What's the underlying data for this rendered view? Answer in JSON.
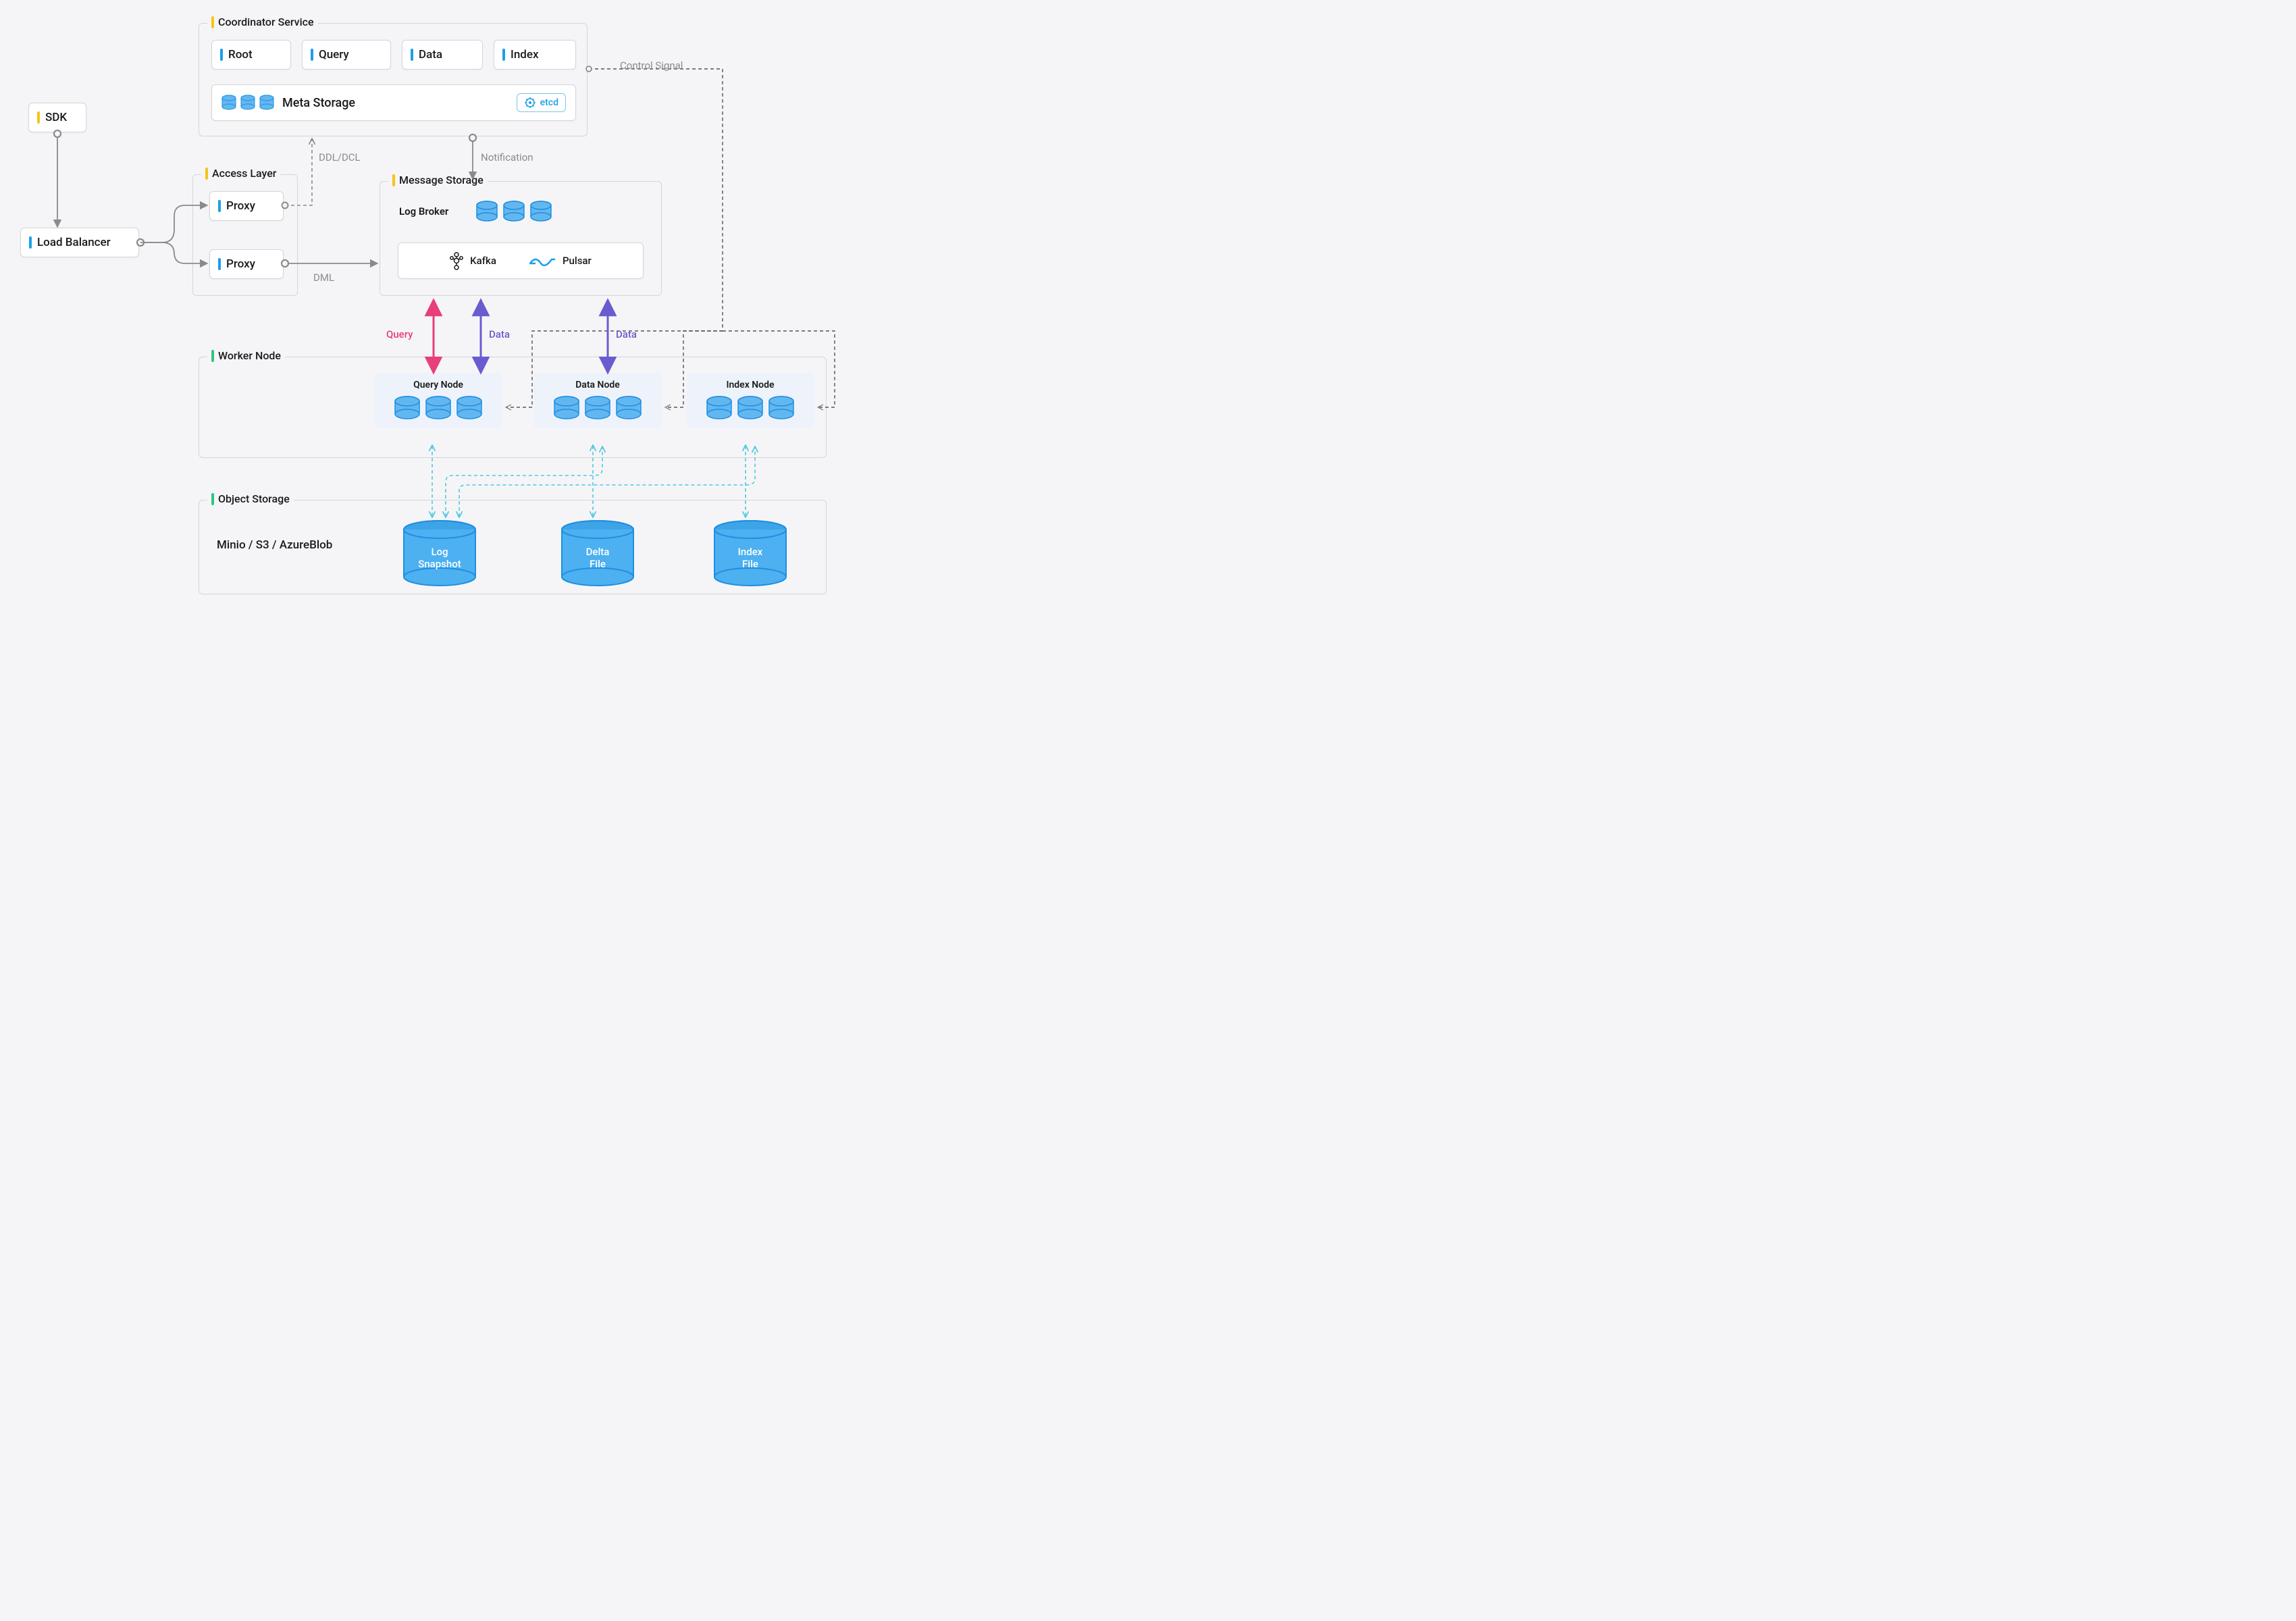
{
  "sdk": {
    "label": "SDK"
  },
  "load_balancer": {
    "label": "Load Balancer"
  },
  "access_layer": {
    "title": "Access Layer",
    "proxy1": "Proxy",
    "proxy2": "Proxy"
  },
  "coordinator": {
    "title": "Coordinator Service",
    "root": "Root",
    "query": "Query",
    "data": "Data",
    "index": "Index",
    "meta_storage": "Meta Storage",
    "etcd": "etcd"
  },
  "message_storage": {
    "title": "Message Storage",
    "log_broker": "Log Broker",
    "kafka": "Kafka",
    "pulsar": "Pulsar"
  },
  "worker": {
    "title": "Worker Node",
    "query_node": "Query Node",
    "data_node": "Data Node",
    "index_node": "Index Node"
  },
  "object_storage": {
    "title": "Object Storage",
    "providers": "Minio / S3 / AzureBlob",
    "log_snapshot": "Log\nSnapshot",
    "delta_file": "Delta\nFile",
    "index_file": "Index\nFile"
  },
  "edges": {
    "ddl_dcl": "DDL/DCL",
    "dml": "DML",
    "notification": "Notification",
    "control_signal": "Control Signal",
    "query": "Query",
    "data1": "Data",
    "data2": "Data"
  },
  "colors": {
    "gray": "#8a8a8e",
    "cyan": "#1aa0e8",
    "blue_fill": "#63b7f0",
    "blue_stroke": "#1f8fe0",
    "purple": "#6a5cd0",
    "pink": "#e83e7a",
    "teal": "#4fc9e0",
    "yellow": "#f5c518",
    "green": "#2ec77c"
  }
}
